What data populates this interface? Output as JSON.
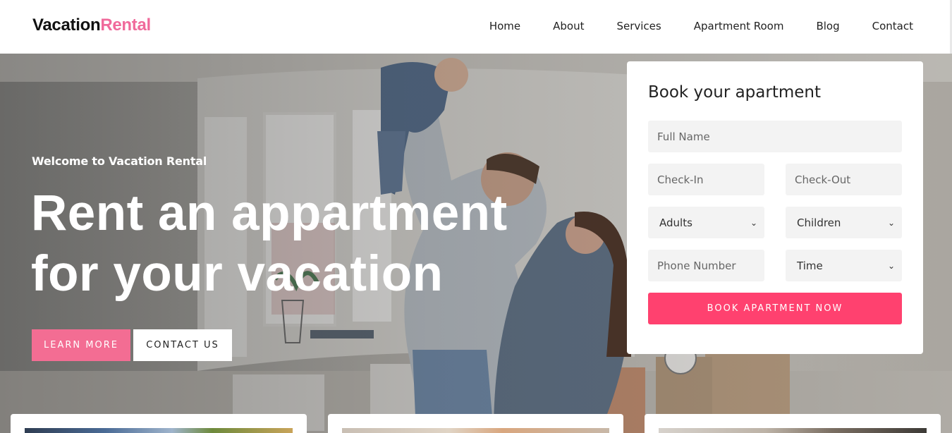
{
  "brand": {
    "part1": "Vacation",
    "part2": "Rental",
    "accent_color": "#f06a9b"
  },
  "nav": {
    "items": [
      {
        "label": "Home"
      },
      {
        "label": "About"
      },
      {
        "label": "Services"
      },
      {
        "label": "Apartment Room"
      },
      {
        "label": "Blog"
      },
      {
        "label": "Contact"
      }
    ]
  },
  "hero": {
    "eyebrow": "Welcome to Vacation Rental",
    "headline_line1": "Rent an appartment",
    "headline_line2": "for your vacation",
    "learn_more": "LEARN MORE",
    "contact_us": "CONTACT US",
    "learn_more_color": "#f36d93"
  },
  "booking": {
    "title": "Book your apartment",
    "full_name_placeholder": "Full Name",
    "check_in_placeholder": "Check-In",
    "check_out_placeholder": "Check-Out",
    "adults_selected": "Adults",
    "children_selected": "Children",
    "phone_placeholder": "Phone Number",
    "time_selected": "Time",
    "submit_label": "BOOK APARTMENT NOW",
    "submit_color": "#ff416f"
  },
  "icons": {
    "select_arrow": "chevron-down-icon"
  }
}
